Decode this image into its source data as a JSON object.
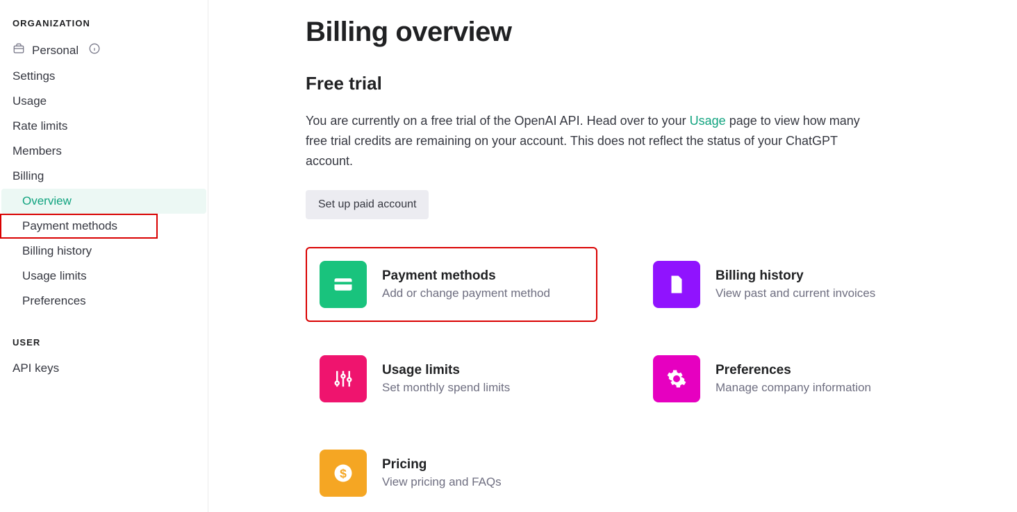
{
  "sidebar": {
    "org_header": "ORGANIZATION",
    "personal_label": "Personal",
    "items": {
      "settings": "Settings",
      "usage": "Usage",
      "rate_limits": "Rate limits",
      "members": "Members",
      "billing": "Billing"
    },
    "billing_sub": {
      "overview": "Overview",
      "payment_methods": "Payment methods",
      "billing_history": "Billing history",
      "usage_limits": "Usage limits",
      "preferences": "Preferences"
    },
    "user_header": "USER",
    "user_items": {
      "api_keys": "API keys"
    }
  },
  "main": {
    "title": "Billing overview",
    "section_title": "Free trial",
    "desc_before_link": "You are currently on a free trial of the OpenAI API. Head over to your ",
    "usage_link": "Usage",
    "desc_after_link": " page to view how many free trial credits are remaining on your account. This does not reflect the status of your ChatGPT account.",
    "setup_button": "Set up paid account"
  },
  "cards": {
    "payment_methods": {
      "title": "Payment methods",
      "sub": "Add or change payment method"
    },
    "billing_history": {
      "title": "Billing history",
      "sub": "View past and current invoices"
    },
    "usage_limits": {
      "title": "Usage limits",
      "sub": "Set monthly spend limits"
    },
    "preferences": {
      "title": "Preferences",
      "sub": "Manage company information"
    },
    "pricing": {
      "title": "Pricing",
      "sub": "View pricing and FAQs"
    }
  }
}
